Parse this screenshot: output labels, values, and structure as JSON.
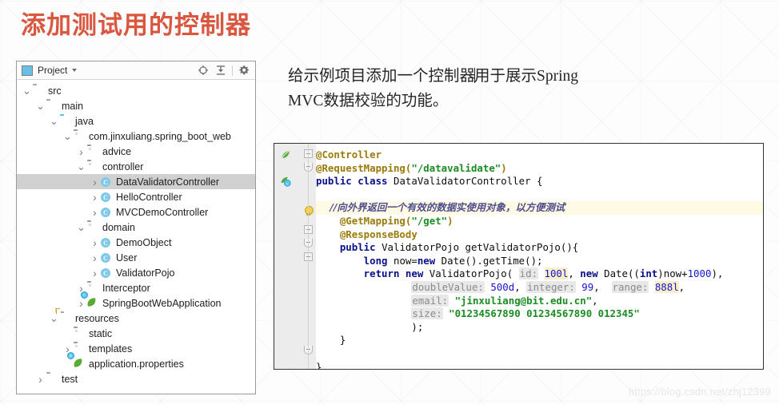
{
  "page": {
    "title": "添加测试用的控制器",
    "title_color": "#d9563f",
    "watermark": "https://blog.csdn.net/zhj12399"
  },
  "project_panel": {
    "toolbar": {
      "title": "Project",
      "dropdown_caret": "chevron-down-icon",
      "buttons": [
        {
          "name": "locate-icon",
          "label": "⊕"
        },
        {
          "name": "collapse-all-icon",
          "label": "⇟"
        },
        {
          "name": "settings-gear-icon",
          "label": "⚙"
        }
      ]
    },
    "tree": [
      {
        "label": "src",
        "icon": "folder",
        "twist": "down",
        "indent": 0,
        "selected": false
      },
      {
        "label": "main",
        "icon": "folder",
        "twist": "down",
        "indent": 1,
        "selected": false
      },
      {
        "label": "java",
        "icon": "folder-blue",
        "twist": "down",
        "indent": 2,
        "selected": false
      },
      {
        "label": "com.jinxuliang.spring_boot_web",
        "icon": "package",
        "twist": "down",
        "indent": 3,
        "selected": false
      },
      {
        "label": "advice",
        "icon": "package",
        "twist": "right",
        "indent": 4,
        "selected": false
      },
      {
        "label": "controller",
        "icon": "package",
        "twist": "down",
        "indent": 4,
        "selected": false
      },
      {
        "label": "DataValidatorController",
        "icon": "class",
        "twist": "right",
        "indent": 5,
        "selected": true
      },
      {
        "label": "HelloController",
        "icon": "class",
        "twist": "right",
        "indent": 5,
        "selected": false
      },
      {
        "label": "MVCDemoController",
        "icon": "class",
        "twist": "right",
        "indent": 5,
        "selected": false
      },
      {
        "label": "domain",
        "icon": "package",
        "twist": "down",
        "indent": 4,
        "selected": false
      },
      {
        "label": "DemoObject",
        "icon": "class",
        "twist": "right",
        "indent": 5,
        "selected": false
      },
      {
        "label": "User",
        "icon": "class",
        "twist": "right",
        "indent": 5,
        "selected": false
      },
      {
        "label": "ValidatorPojo",
        "icon": "class",
        "twist": "right",
        "indent": 5,
        "selected": false
      },
      {
        "label": "Interceptor",
        "icon": "package",
        "twist": "right",
        "indent": 4,
        "selected": false
      },
      {
        "label": "SpringBootWebApplication",
        "icon": "spring-class",
        "twist": "right",
        "indent": 4,
        "selected": false
      },
      {
        "label": "resources",
        "icon": "folder-resource",
        "twist": "down",
        "indent": 2,
        "selected": false
      },
      {
        "label": "static",
        "icon": "package",
        "twist": "none",
        "indent": 3,
        "selected": false
      },
      {
        "label": "templates",
        "icon": "package",
        "twist": "right",
        "indent": 3,
        "selected": false
      },
      {
        "label": "application.properties",
        "icon": "spring-file",
        "twist": "none",
        "indent": 3,
        "selected": false
      },
      {
        "label": "test",
        "icon": "folder",
        "twist": "right",
        "indent": 1,
        "selected": false
      }
    ]
  },
  "description": {
    "line1_a": "给示例项目添加一个控制器",
    "line1_b": "用于展示Spring",
    "line2": "MVC数据校验的功能。"
  },
  "code": {
    "gutter_icons": [
      {
        "name": "spring-leaf-icon"
      },
      {
        "name": "spring-bean-icon"
      }
    ],
    "lines": [
      {
        "tokens": [
          {
            "t": "ann",
            "v": "@Controller"
          }
        ]
      },
      {
        "tokens": [
          {
            "t": "ann",
            "v": "@RequestMapping("
          },
          {
            "t": "str",
            "v": "\"/datavalidate\""
          },
          {
            "t": "ann",
            "v": ")"
          }
        ]
      },
      {
        "tokens": [
          {
            "t": "kw",
            "v": "public class "
          },
          {
            "t": "plain",
            "v": "DataValidatorController {"
          }
        ]
      },
      {
        "tokens": []
      },
      {
        "highlight": true,
        "tokens": [
          {
            "t": "cmt",
            "v": "    //向外界返回一个有效的数据实使用对象，以方便测试"
          }
        ]
      },
      {
        "tokens": [
          {
            "t": "ann",
            "v": "    @GetMapping("
          },
          {
            "t": "str",
            "v": "\"/get\""
          },
          {
            "t": "ann",
            "v": ")"
          }
        ]
      },
      {
        "tokens": [
          {
            "t": "ann",
            "v": "    @ResponseBody"
          }
        ]
      },
      {
        "tokens": [
          {
            "t": "kw",
            "v": "    public "
          },
          {
            "t": "plain",
            "v": "ValidatorPojo getValidatorPojo(){"
          }
        ]
      },
      {
        "tokens": [
          {
            "t": "kw",
            "v": "        long "
          },
          {
            "t": "plain",
            "v": "now="
          },
          {
            "t": "kw",
            "v": "new "
          },
          {
            "t": "plain",
            "v": "Date().getTime();"
          }
        ]
      },
      {
        "tokens": [
          {
            "t": "kw",
            "v": "        return new "
          },
          {
            "t": "plain",
            "v": "ValidatorPojo( "
          },
          {
            "t": "hint",
            "v": "id:"
          },
          {
            "t": "plain",
            "v": " "
          },
          {
            "t": "numhl",
            "v": "100l"
          },
          {
            "t": "plain",
            "v": ", "
          },
          {
            "t": "kw",
            "v": "new "
          },
          {
            "t": "plain",
            "v": "Date(("
          },
          {
            "t": "kw",
            "v": "int"
          },
          {
            "t": "plain",
            "v": ")now+"
          },
          {
            "t": "num",
            "v": "1000"
          },
          {
            "t": "plain",
            "v": "),"
          }
        ]
      },
      {
        "tokens": [
          {
            "t": "plain",
            "v": "                "
          },
          {
            "t": "hint",
            "v": "doubleValue:"
          },
          {
            "t": "plain",
            "v": " "
          },
          {
            "t": "num",
            "v": "500d"
          },
          {
            "t": "plain",
            "v": ", "
          },
          {
            "t": "hint",
            "v": "integer:"
          },
          {
            "t": "plain",
            "v": " "
          },
          {
            "t": "num",
            "v": "99"
          },
          {
            "t": "plain",
            "v": ",  "
          },
          {
            "t": "hint",
            "v": "range:"
          },
          {
            "t": "plain",
            "v": " "
          },
          {
            "t": "numhl",
            "v": "888l"
          },
          {
            "t": "plain",
            "v": ","
          }
        ]
      },
      {
        "tokens": [
          {
            "t": "plain",
            "v": "                "
          },
          {
            "t": "hint",
            "v": "email:"
          },
          {
            "t": "plain",
            "v": " "
          },
          {
            "t": "str",
            "v": "\"jinxuliang@bit.edu.cn\""
          },
          {
            "t": "plain",
            "v": ","
          }
        ]
      },
      {
        "tokens": [
          {
            "t": "plain",
            "v": "                "
          },
          {
            "t": "hint",
            "v": "size:"
          },
          {
            "t": "plain",
            "v": " "
          },
          {
            "t": "str",
            "v": "\"01234567890 01234567890 012345\""
          }
        ]
      },
      {
        "tokens": [
          {
            "t": "plain",
            "v": "                );"
          }
        ]
      },
      {
        "tokens": [
          {
            "t": "plain",
            "v": "    }"
          }
        ]
      },
      {
        "tokens": []
      },
      {
        "tokens": [
          {
            "t": "plain",
            "v": "}"
          }
        ]
      }
    ]
  }
}
